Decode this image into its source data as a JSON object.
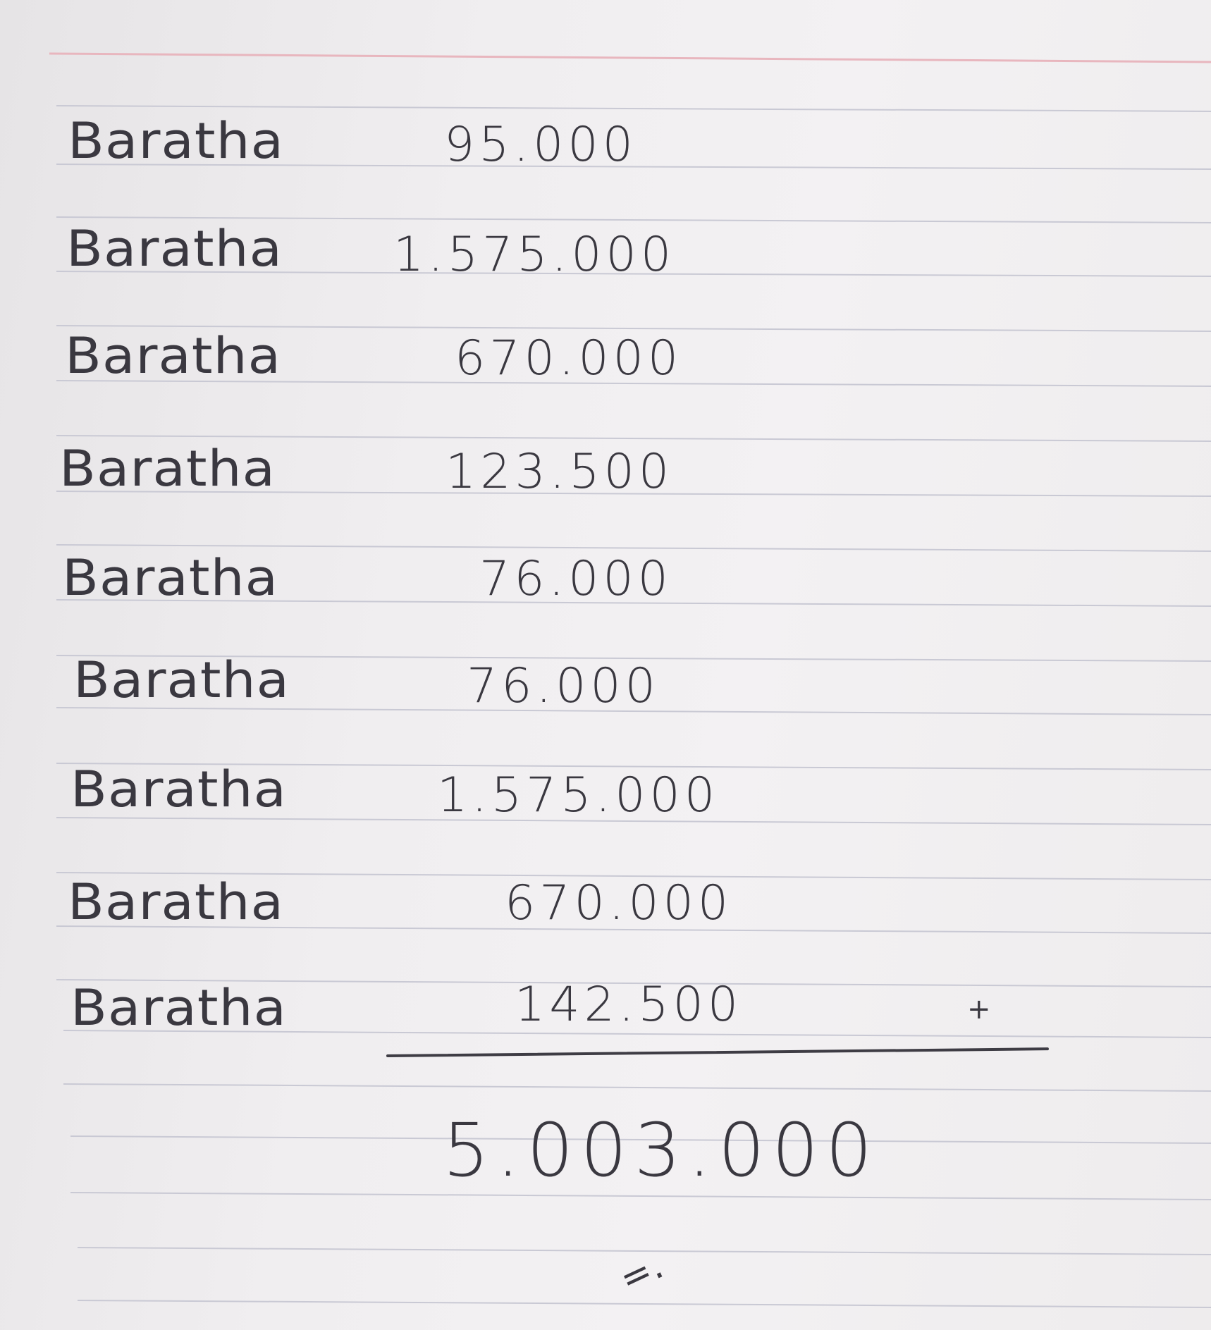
{
  "rows": [
    {
      "name": "Baratha",
      "amount": "95.000"
    },
    {
      "name": "Baratha",
      "amount": "1.575.000"
    },
    {
      "name": "Baratha",
      "amount": "670.000"
    },
    {
      "name": "Baratha",
      "amount": "123.500"
    },
    {
      "name": "Baratha",
      "amount": "76.000"
    },
    {
      "name": "Baratha",
      "amount": "76.000"
    },
    {
      "name": "Baratha",
      "amount": "1.575.000"
    },
    {
      "name": "Baratha",
      "amount": "670.000"
    },
    {
      "name": "Baratha",
      "amount": "142.500"
    }
  ],
  "plus_sign": "+",
  "total": "5.003.000",
  "end_mark": "=."
}
